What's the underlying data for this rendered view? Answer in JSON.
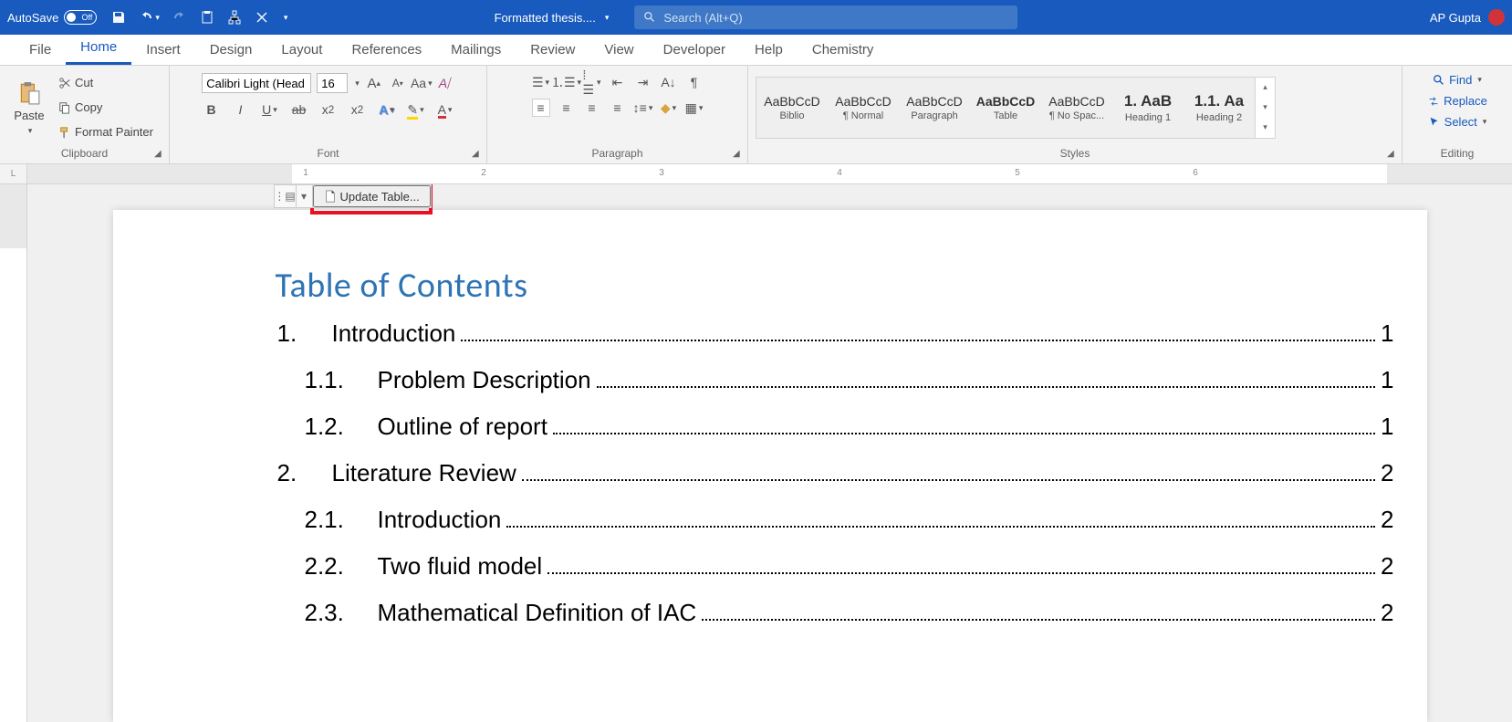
{
  "titlebar": {
    "autosave": "AutoSave",
    "autosave_state": "Off",
    "doc_title": "Formatted thesis....",
    "search_placeholder": "Search (Alt+Q)",
    "user": "AP Gupta"
  },
  "tabs": [
    "File",
    "Home",
    "Insert",
    "Design",
    "Layout",
    "References",
    "Mailings",
    "Review",
    "View",
    "Developer",
    "Help",
    "Chemistry"
  ],
  "active_tab": "Home",
  "clipboard": {
    "paste": "Paste",
    "cut": "Cut",
    "copy": "Copy",
    "painter": "Format Painter",
    "label": "Clipboard"
  },
  "font": {
    "name": "Calibri Light (Head",
    "size": "16",
    "label": "Font"
  },
  "paragraph": {
    "label": "Paragraph"
  },
  "styles": {
    "label": "Styles",
    "items": [
      {
        "preview": "AaBbCcD",
        "label": "Biblio"
      },
      {
        "preview": "AaBbCcD",
        "label": "¶ Normal"
      },
      {
        "preview": "AaBbCcD",
        "label": "Paragraph"
      },
      {
        "preview": "AaBbCcD",
        "label": "Table",
        "bold": true
      },
      {
        "preview": "AaBbCcD",
        "label": "¶ No Spac..."
      },
      {
        "preview": "1. AaB",
        "label": "Heading 1",
        "bold": true,
        "big": true
      },
      {
        "preview": "1.1. Aa",
        "label": "Heading 2",
        "bold": true,
        "big": true
      }
    ]
  },
  "editing": {
    "find": "Find",
    "replace": "Replace",
    "select": "Select",
    "label": "Editing"
  },
  "toc_toolbar": {
    "update": "Update Table..."
  },
  "doc": {
    "heading": "Table of Contents",
    "entries": [
      {
        "lv": 1,
        "num": "1.",
        "title": "Introduction",
        "page": "1"
      },
      {
        "lv": 2,
        "num": "1.1.",
        "title": "Problem Description",
        "page": "1"
      },
      {
        "lv": 2,
        "num": "1.2.",
        "title": "Outline of report",
        "page": "1"
      },
      {
        "lv": 1,
        "num": "2.",
        "title": "Literature Review",
        "page": "2"
      },
      {
        "lv": 2,
        "num": "2.1.",
        "title": "Introduction",
        "page": "2"
      },
      {
        "lv": 2,
        "num": "2.2.",
        "title": "Two fluid model",
        "page": "2"
      },
      {
        "lv": 2,
        "num": "2.3.",
        "title": "Mathematical Definition of IAC",
        "page": "2"
      }
    ]
  }
}
